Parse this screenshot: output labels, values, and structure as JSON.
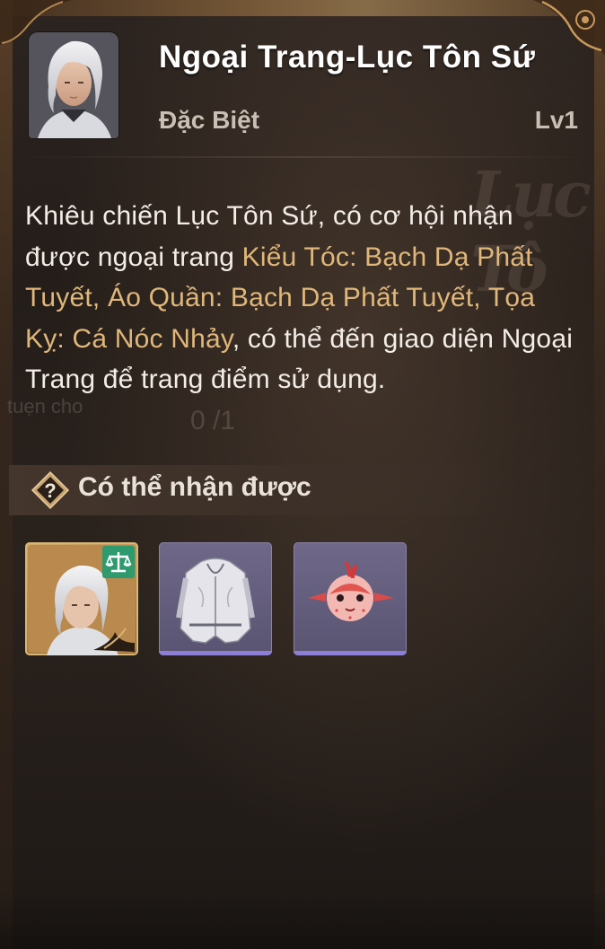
{
  "header": {
    "title": "Ngoại Trang-Lục Tôn Sứ",
    "rarity": "Đặc Biệt",
    "level": "Lv1"
  },
  "description": {
    "part1": "Khiêu chiến Lục Tôn Sứ, có cơ hội nhận được ngoại trang ",
    "highlight": "Kiểu Tóc: Bạch Dạ Phất Tuyết, Áo Quần: Bạch Dạ Phất Tuyết, Tọa Kỵ: Cá Nóc Nhảy",
    "part2": ", có thể đến giao diện Ngoại Trang để trang điểm sử dụng."
  },
  "rewards_section": {
    "title": "Có thể nhận được",
    "items": [
      {
        "name": "hairstyle-portrait",
        "rarity_color": "#c8995a"
      },
      {
        "name": "outfit-white-coat",
        "rarity_color": "#8e7fd6"
      },
      {
        "name": "mount-pufferfish",
        "rarity_color": "#8e7fd6"
      }
    ]
  },
  "background": {
    "ghost_label": "tuẹn cho",
    "ghost_counter": "0 /1"
  },
  "colors": {
    "highlight": "#e0b77a",
    "text": "#f2ede6",
    "muted": "#c9bfb3"
  }
}
